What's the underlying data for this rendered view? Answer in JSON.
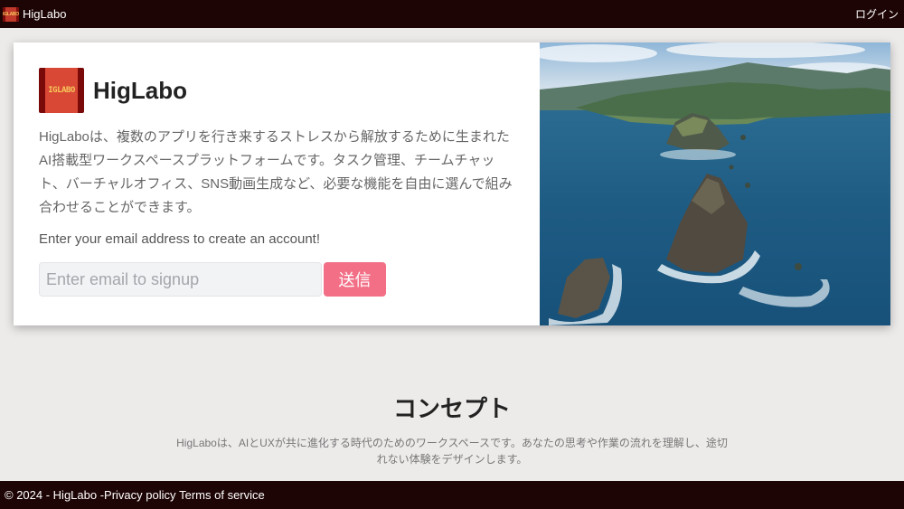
{
  "nav": {
    "brand": "HigLabo",
    "login": "ログイン",
    "logo_text": "IGLABO"
  },
  "hero": {
    "title": "HigLabo",
    "logo_text": "IGLABO",
    "description": "HigLaboは、複数のアプリを行き来するストレスから解放するために生まれたAI搭載型ワークスペースプラットフォームです。タスク管理、チームチャット、バーチャルオフィス、SNS動画生成など、必要な機能を自由に選んで組み合わせることができます。",
    "prompt": "Enter your email address to create an account!",
    "email_placeholder": "Enter email to signup",
    "send_label": "送信",
    "image": "coastal-aerial-photo"
  },
  "concept": {
    "title": "コンセプト",
    "text": "HigLaboは、AIとUXが共に進化する時代のためのワークスペースです。あなたの思考や作業の流れを理解し、途切れない体験をデザインします。"
  },
  "footer": {
    "copyright": "© 2024 - HigLabo - ",
    "privacy": "Privacy policy",
    "terms": "Terms of service"
  },
  "colors": {
    "bar": "#1e0505",
    "accent": "#f26f86",
    "background": "#edebea"
  }
}
